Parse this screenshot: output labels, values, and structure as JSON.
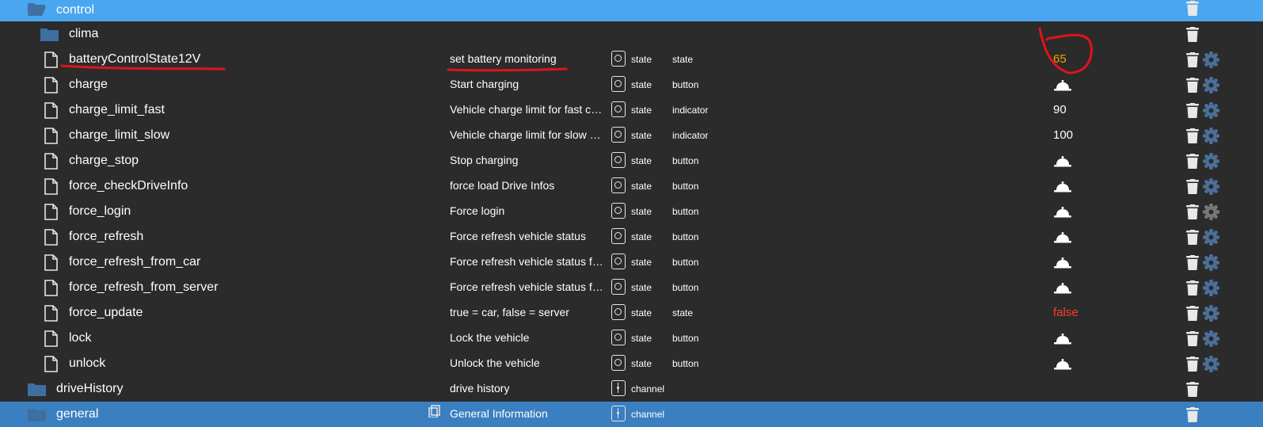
{
  "colors": {
    "selected_row": "#4aa6ee",
    "background": "#2b2b2b",
    "folder_blue": "#3e6fa1",
    "value_orange": "#f5a300",
    "value_red": "#ff3c2c",
    "gear_blue": "#4c6f99",
    "annotation_red": "#e0131a"
  },
  "rows": [
    {
      "name": "control",
      "icon": "folder-open-icon",
      "selected": true
    },
    {
      "name": "clima",
      "icon": "folder-icon"
    },
    {
      "name": "batteryControlState12V",
      "desc": "set battery monitoring",
      "type": "state",
      "role": "state",
      "value": "65"
    },
    {
      "name": "charge",
      "desc": "Start charging",
      "type": "state",
      "role": "button",
      "value": "bell-icon"
    },
    {
      "name": "charge_limit_fast",
      "desc": "Vehicle charge limit for fast charging",
      "type": "state",
      "role": "indicator",
      "value": "90"
    },
    {
      "name": "charge_limit_slow",
      "desc": "Vehicle charge limit for slow charging",
      "type": "state",
      "role": "indicator",
      "value": "100"
    },
    {
      "name": "charge_stop",
      "desc": "Stop charging",
      "type": "state",
      "role": "button",
      "value": "bell-icon"
    },
    {
      "name": "force_checkDriveInfo",
      "desc": "force load Drive Infos",
      "type": "state",
      "role": "button",
      "value": "bell-icon"
    },
    {
      "name": "force_login",
      "desc": "Force login",
      "type": "state",
      "role": "button",
      "value": "bell-icon"
    },
    {
      "name": "force_refresh",
      "desc": "Force refresh vehicle status",
      "type": "state",
      "role": "button",
      "value": "bell-icon"
    },
    {
      "name": "force_refresh_from_car",
      "desc": "Force refresh vehicle status from car",
      "type": "state",
      "role": "button",
      "value": "bell-icon"
    },
    {
      "name": "force_refresh_from_server",
      "desc": "Force refresh vehicle status from server",
      "type": "state",
      "role": "button",
      "value": "bell-icon"
    },
    {
      "name": "force_update",
      "desc": "true = car, false = server",
      "type": "state",
      "role": "state",
      "value": "false"
    },
    {
      "name": "lock",
      "desc": "Lock the vehicle",
      "type": "state",
      "role": "button",
      "value": "bell-icon"
    },
    {
      "name": "unlock",
      "desc": "Unlock the vehicle",
      "type": "state",
      "role": "button",
      "value": "bell-icon"
    },
    {
      "name": "driveHistory",
      "desc": "drive history",
      "type": "channel",
      "icon": "folder-icon"
    },
    {
      "name": "general",
      "desc": "General Information",
      "type": "channel",
      "icon": "folder-icon",
      "selected": true
    }
  ]
}
